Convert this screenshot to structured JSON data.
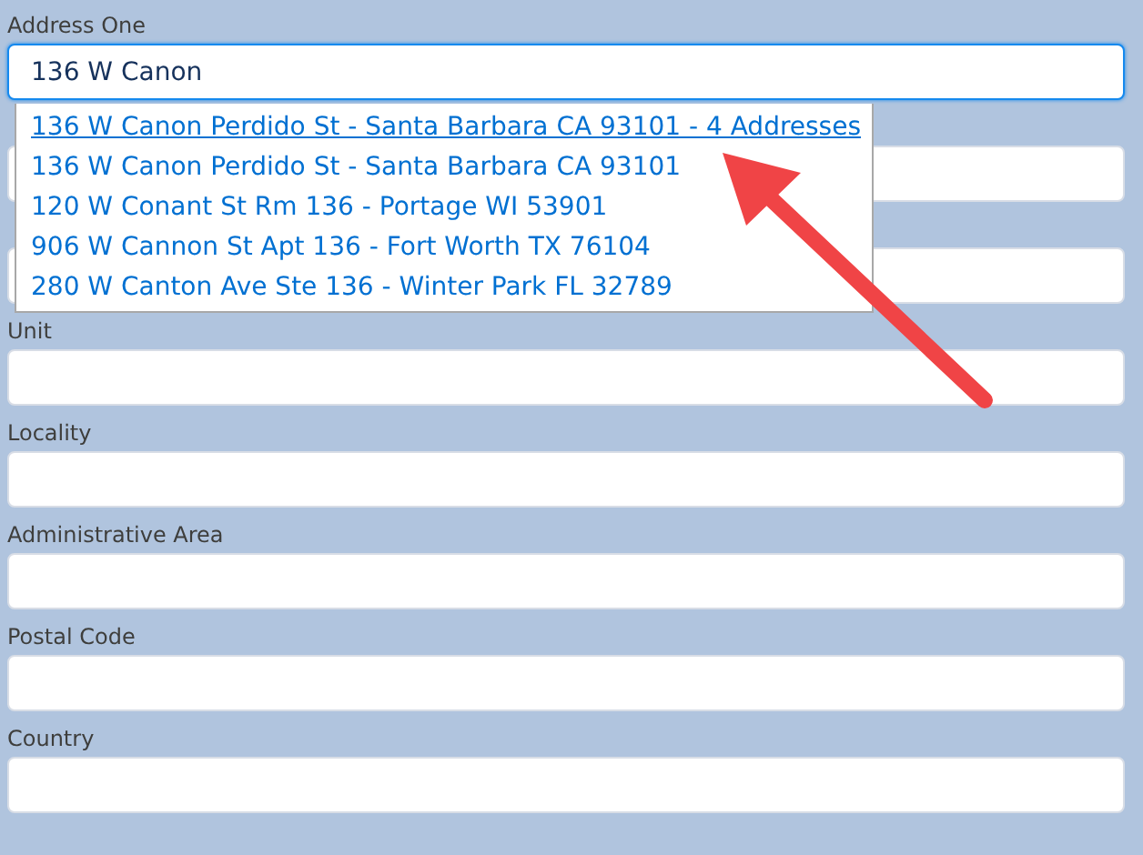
{
  "fields": [
    {
      "label": "Address One",
      "value": "136 W Canon",
      "focused": true
    },
    {
      "focused": false
    },
    {
      "focused": false
    },
    {
      "label": "Unit",
      "focused": false
    },
    {
      "label": "Locality",
      "focused": false
    },
    {
      "label": "Administrative Area",
      "focused": false
    },
    {
      "label": "Postal Code",
      "focused": false
    },
    {
      "label": "Country",
      "focused": false
    }
  ],
  "suggestions": [
    {
      "text": "136 W Canon Perdido St - Santa Barbara CA 93101 - 4 Addresses",
      "selected": true
    },
    {
      "text": "136 W Canon Perdido St - Santa Barbara CA 93101",
      "selected": false
    },
    {
      "text": "120 W Conant St Rm 136 - Portage WI 53901",
      "selected": false
    },
    {
      "text": "906 W Cannon St Apt 136 - Fort Worth TX 76104",
      "selected": false
    },
    {
      "text": "280 W Canton Ave Ste 136 - Winter Park FL 32789",
      "selected": false
    }
  ]
}
